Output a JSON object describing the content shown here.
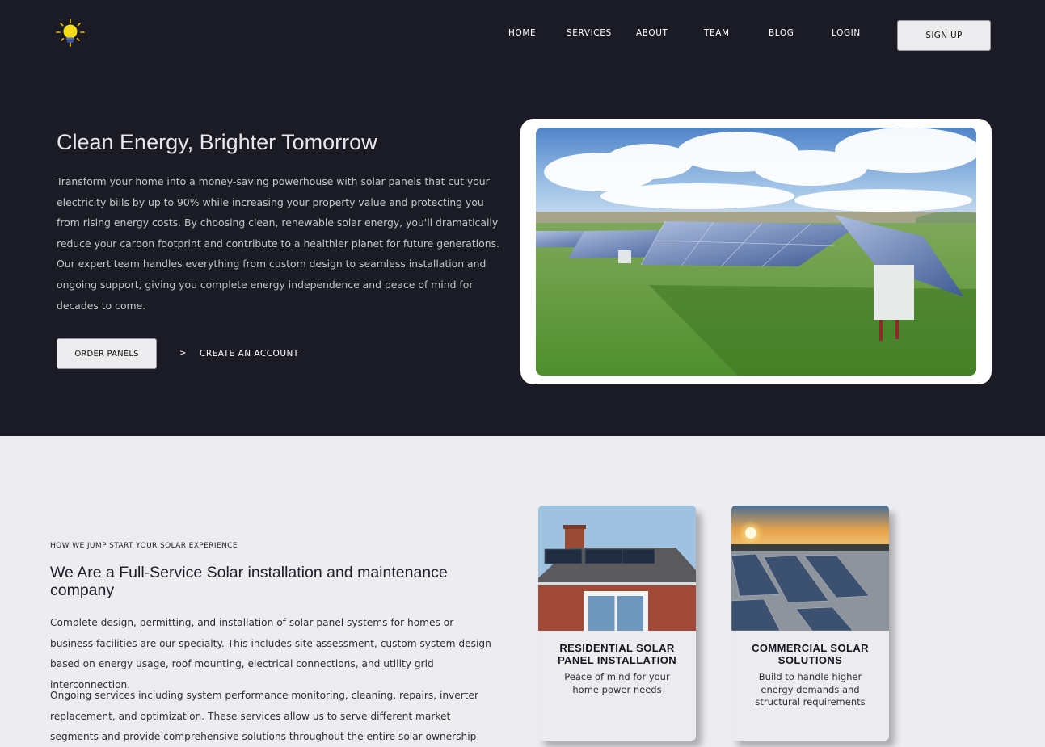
{
  "nav": {
    "items": [
      {
        "label": "HOME"
      },
      {
        "label": "SERVICES"
      },
      {
        "label": "ABOUT"
      },
      {
        "label": "TEAM"
      },
      {
        "label": "BLOG"
      },
      {
        "label": "LOGIN"
      }
    ],
    "signup_label": "SIGN UP"
  },
  "logo": {
    "icon": "lightbulb-icon",
    "color": "#f5d90a"
  },
  "hero": {
    "title": "Clean Energy, Brighter Tomorrow",
    "body": "Transform your home into a money-saving powerhouse with solar panels that cut your electricity bills by up to 90% while increasing your property value and protecting you from rising energy costs. By choosing clean, renewable solar energy, you'll dramatically reduce your carbon footprint and contribute to a healthier planet for future generations. Our expert team handles everything from custom design to seamless installation and ongoing support, giving you complete energy independence and peace of mind for decades to come.",
    "order_label": "ORDER PANELS",
    "create_arrow": ">",
    "create_label": "CREATE AN ACCOUNT"
  },
  "services": {
    "eyebrow": "HOW WE JUMP START YOUR SOLAR EXPERIENCE",
    "title": "We Are a Full-Service Solar installation and maintenance company",
    "p1": "Complete design, permitting, and installation of solar panel systems for homes or business facilities are our specialty. This includes site assessment, custom system design based on energy usage, roof mounting, electrical connections, and utility grid interconnection.",
    "p2": "Ongoing services including system performance monitoring, cleaning, repairs, inverter replacement, and optimization. These services allow us to serve different market segments and provide comprehensive solutions throughout the entire solar ownership lifecycle, from",
    "cards": [
      {
        "title": "RESIDENTIAL SOLAR PANEL INSTALLATION",
        "desc": "Peace of mind for your home power needs"
      },
      {
        "title": "COMMERCIAL SOLAR SOLUTIONS",
        "desc": "Build to handle higher energy demands and structural requirements"
      }
    ]
  },
  "colors": {
    "hero_bg": "#1b1b26",
    "page_bg": "#ededf1",
    "button_bg": "#ececef"
  }
}
